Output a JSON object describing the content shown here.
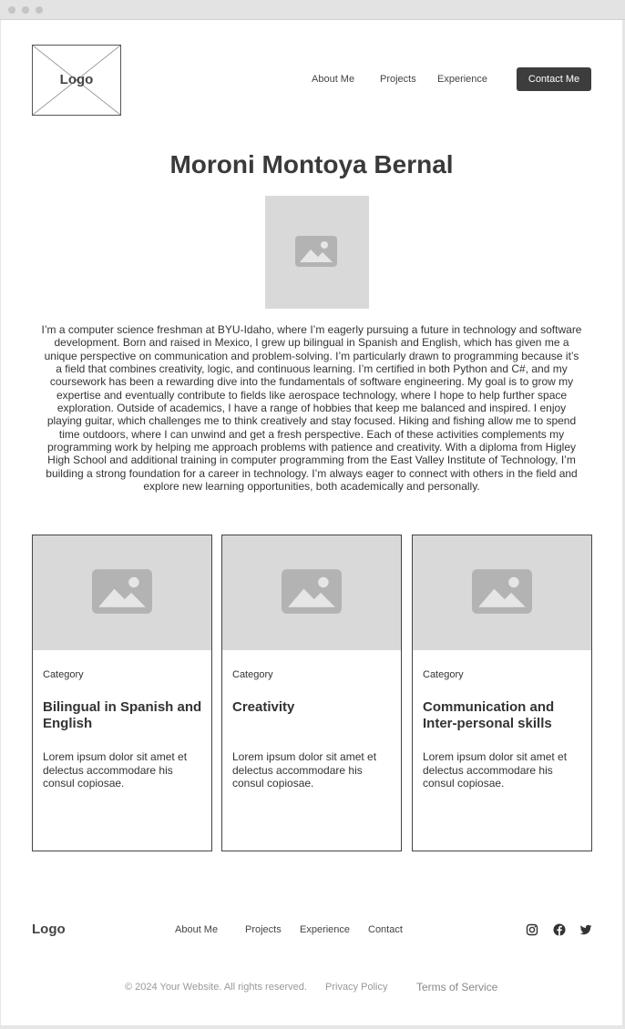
{
  "header": {
    "logo": "Logo",
    "nav": [
      "About Me",
      "Projects",
      "Experience"
    ],
    "contact_button": "Contact Me"
  },
  "hero": {
    "name": "Moroni Montoya Bernal",
    "image_icon": "image-placeholder-icon",
    "bio": "I’m a computer science freshman at BYU-Idaho, where I’m eagerly pursuing a future in technology and software development. Born and raised in Mexico, I grew up bilingual in Spanish and English, which has given me a unique perspective on communication and problem-solving. I’m particularly drawn to programming because it’s a field that combines creativity, logic, and continuous learning. I’m certified in both Python and C#, and my coursework has been a rewarding dive into the fundamentals of software engineering. My goal is to grow my expertise and eventually contribute to fields like aerospace technology, where I hope to help further space exploration. Outside of academics, I have a range of hobbies that keep me balanced and inspired. I enjoy playing guitar, which challenges me to think creatively and stay focused. Hiking and fishing allow me to spend time outdoors, where I can unwind and get a fresh perspective. Each of these activities complements my programming work by helping me approach problems with patience and creativity. With a diploma from Higley High School and additional training in computer programming from the East Valley Institute of Technology, I’m building a strong foundation for a career in technology. I’m always eager to connect with others in the field and explore new learning opportunities, both academically and personally."
  },
  "cards": [
    {
      "category": "Category",
      "title": "Bilingual in Spanish and English",
      "description": "Lorem ipsum dolor sit amet et delectus accommodare his consul copiosae."
    },
    {
      "category": "Category",
      "title": "Creativity",
      "description": "Lorem ipsum dolor sit amet et delectus accommodare his consul copiosae."
    },
    {
      "category": "Category",
      "title": "Communication and Inter-personal skills",
      "description": "Lorem ipsum dolor sit amet et delectus accommodare his consul copiosae."
    }
  ],
  "footer": {
    "logo": "Logo",
    "nav": [
      "About Me",
      "Projects",
      "Experience",
      "Contact"
    ],
    "social_icons": [
      "instagram-icon",
      "facebook-icon",
      "twitter-icon"
    ],
    "copyright": "© 2024 Your Website. All rights reserved.",
    "privacy": "Privacy Policy",
    "terms": "Terms of Service"
  },
  "colors": {
    "accent": "#3d3d3d",
    "placeholder": "#d9d9d9",
    "placeholder_icon": "#b3b3b3"
  }
}
